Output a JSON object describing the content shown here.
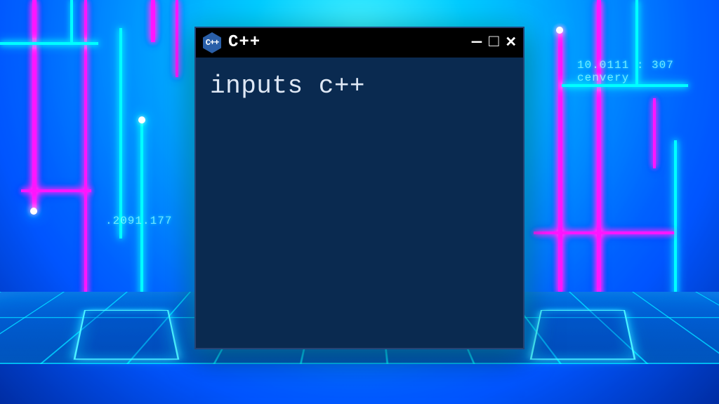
{
  "window": {
    "title": "C++",
    "logo_text": "C++",
    "content": "inputs c++",
    "buttons": {
      "min": "—",
      "max": "□",
      "close": "✕"
    }
  },
  "background": {
    "text_left": ".2091.177",
    "text_right": "10.0111 : 307  cenvery"
  }
}
